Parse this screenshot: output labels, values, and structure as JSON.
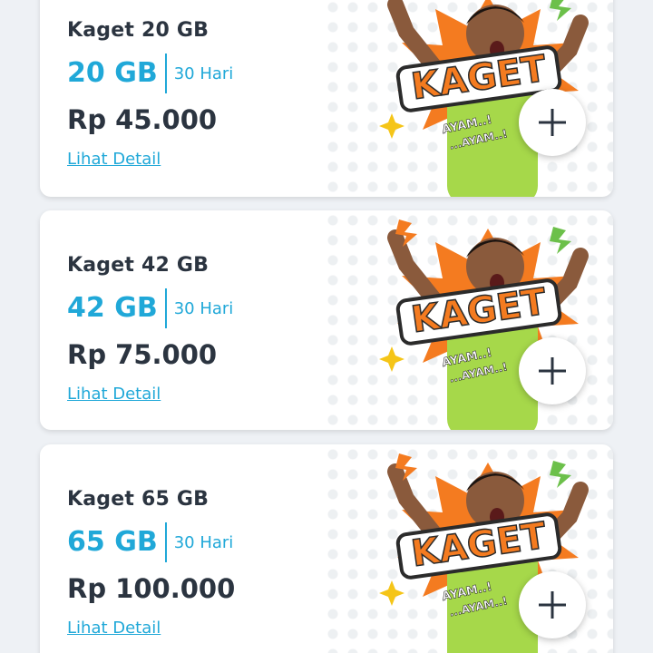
{
  "packages": [
    {
      "name": "Kaget 20 GB",
      "quota": "20 GB",
      "validity": "30 Hari",
      "price": "Rp 45.000",
      "detail_label": "Lihat Detail",
      "badge_text": "KAGET",
      "sticker_text": "AYAM..!",
      "sticker_text_2": "...AYAM..!"
    },
    {
      "name": "Kaget 42 GB",
      "quota": "42 GB",
      "validity": "30 Hari",
      "price": "Rp 75.000",
      "detail_label": "Lihat Detail",
      "badge_text": "KAGET",
      "sticker_text": "AYAM..!",
      "sticker_text_2": "...AYAM..!"
    },
    {
      "name": "Kaget 65 GB",
      "quota": "65 GB",
      "validity": "30 Hari",
      "price": "Rp 100.000",
      "detail_label": "Lihat Detail",
      "badge_text": "KAGET",
      "sticker_text": "AYAM..!",
      "sticker_text_2": "...AYAM..!"
    }
  ],
  "icons": {
    "add": "plus-icon"
  },
  "colors": {
    "accent": "#20a8d8",
    "text_dark": "#2b3440",
    "background": "#eef1f5",
    "badge_orange": "#f47b20",
    "shirt_green": "#a6d84a"
  }
}
